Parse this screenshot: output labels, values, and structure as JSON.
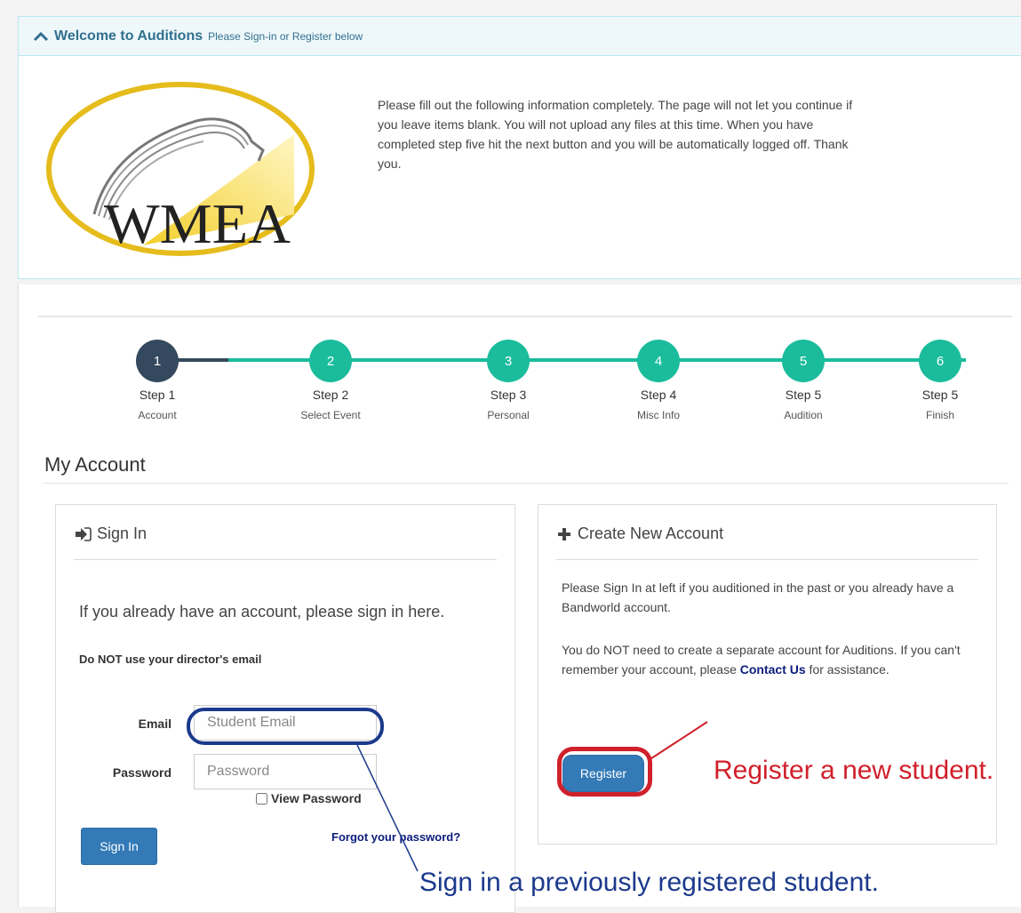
{
  "welcome": {
    "title": "Welcome to Auditions",
    "subtitle": "Please Sign-in or Register below",
    "logo_text": "WMEA",
    "intro": "Please fill out the following information completely. The page will not let you continue if you leave items blank. You will not upload any files at this time. When you have completed step five hit the next button and you will be automatically logged off. Thank you."
  },
  "steps": [
    {
      "num": "1",
      "title": "Step 1",
      "sub": "Account",
      "state": "active"
    },
    {
      "num": "2",
      "title": "Step 2",
      "sub": "Select Event",
      "state": "upcoming"
    },
    {
      "num": "3",
      "title": "Step 3",
      "sub": "Personal",
      "state": "upcoming"
    },
    {
      "num": "4",
      "title": "Step 4",
      "sub": "Misc Info",
      "state": "upcoming"
    },
    {
      "num": "5",
      "title": "Step 5",
      "sub": "Audition",
      "state": "upcoming"
    },
    {
      "num": "6",
      "title": "Step 5",
      "sub": "Finish",
      "state": "upcoming"
    }
  ],
  "colors": {
    "active_step": "#34495e",
    "step": "#1abc9c",
    "primary": "#337ab7",
    "annotation_red": "#d0202b",
    "annotation_blue": "#1b3a8c"
  },
  "account": {
    "heading": "My Account",
    "signin": {
      "title": "Sign In",
      "icon": "sign-in-icon",
      "lead": "If you already have an account, please sign in here.",
      "warning": "Do NOT use your director's email",
      "email_label": "Email",
      "email_placeholder": "Student Email",
      "password_label": "Password",
      "password_placeholder": "Password",
      "view_password": "View Password",
      "button": "Sign In",
      "forgot": "Forgot your password?"
    },
    "create": {
      "title": "Create New Account",
      "icon": "plus-icon",
      "p1": "Please Sign In at left if you auditioned in the past or you already have a Bandworld account.",
      "p2_a": "You do NOT need to create a separate account for Auditions. If you can't remember your account, please ",
      "p2_link": "Contact Us",
      "p2_b": " for assistance.",
      "button": "Register"
    }
  },
  "annotations": {
    "register": "Register a new student.",
    "signin": "Sign in a previously registered student."
  }
}
